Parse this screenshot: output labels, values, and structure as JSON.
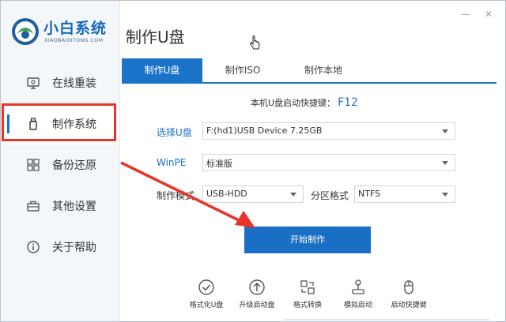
{
  "app": {
    "logo_title": "小白系统",
    "logo_sub": "XIAOBAIXITONG.COM",
    "page_title": "制作U盘"
  },
  "sidebar": {
    "items": [
      {
        "label": "在线重装",
        "icon": "monitor-icon"
      },
      {
        "label": "制作系统",
        "icon": "usb-drive-icon",
        "active": true
      },
      {
        "label": "备份还原",
        "icon": "grid-icon"
      },
      {
        "label": "其他设置",
        "icon": "briefcase-icon"
      },
      {
        "label": "关于帮助",
        "icon": "info-icon"
      }
    ]
  },
  "tabs": [
    {
      "label": "制作U盘",
      "active": true
    },
    {
      "label": "制作ISO"
    },
    {
      "label": "制作本地"
    }
  ],
  "form": {
    "hotkey_label": "本机U盘启动快捷键：",
    "hotkey_value": "F12",
    "usb_label": "选择U盘",
    "usb_value": "F:(hd1)USB Device 7.25GB",
    "winpe_label": "WinPE",
    "winpe_value": "标准版",
    "mode_label": "制作模式",
    "mode_value": "USB-HDD",
    "partition_label": "分区格式",
    "partition_value": "NTFS",
    "start_button": "开始制作"
  },
  "tools": [
    {
      "label": "格式化U盘",
      "icon": "check-circle-icon"
    },
    {
      "label": "升级启动盘",
      "icon": "upload-circle-icon"
    },
    {
      "label": "格式转换",
      "icon": "convert-icon"
    },
    {
      "label": "模拟启动",
      "icon": "joystick-icon"
    },
    {
      "label": "启动快捷键",
      "icon": "mouse-icon"
    }
  ],
  "colors": {
    "accent": "#1a73c9",
    "annotation_red": "#e8342a"
  }
}
